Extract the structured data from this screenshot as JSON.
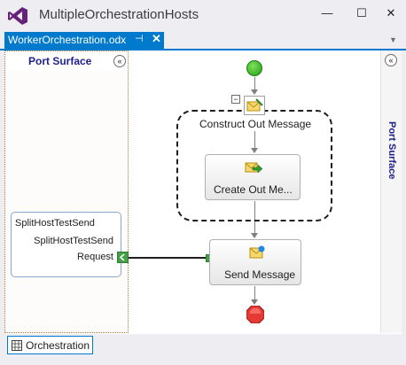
{
  "window": {
    "title": "MultipleOrchestrationHosts",
    "minimize_glyph": "—",
    "maximize_glyph": "☐",
    "close_glyph": "✕"
  },
  "document_tab": {
    "label": "WorkerOrchestration.odx",
    "pin_glyph": "⊣",
    "close_glyph": "✕",
    "dropdown_glyph": "▼"
  },
  "port_surface_left": {
    "title": "Port Surface",
    "collapse_glyph": "«",
    "port": {
      "title": "SplitHostTestSend",
      "name": "SplitHostTestSend",
      "operation": "Request"
    }
  },
  "port_surface_right": {
    "title": "Port Surface",
    "collapse_glyph": "«"
  },
  "orchestration": {
    "scope_toggle": "−",
    "construct_label": "Construct Out Message",
    "create_step_label": "Create Out Me...",
    "send_step_label": "Send Message"
  },
  "bottom_tabs": [
    {
      "label": "Orchestration"
    }
  ],
  "colors": {
    "accent": "#007acc",
    "start": "#2db024",
    "end": "#d32f2f",
    "port_handle": "#43a047"
  }
}
